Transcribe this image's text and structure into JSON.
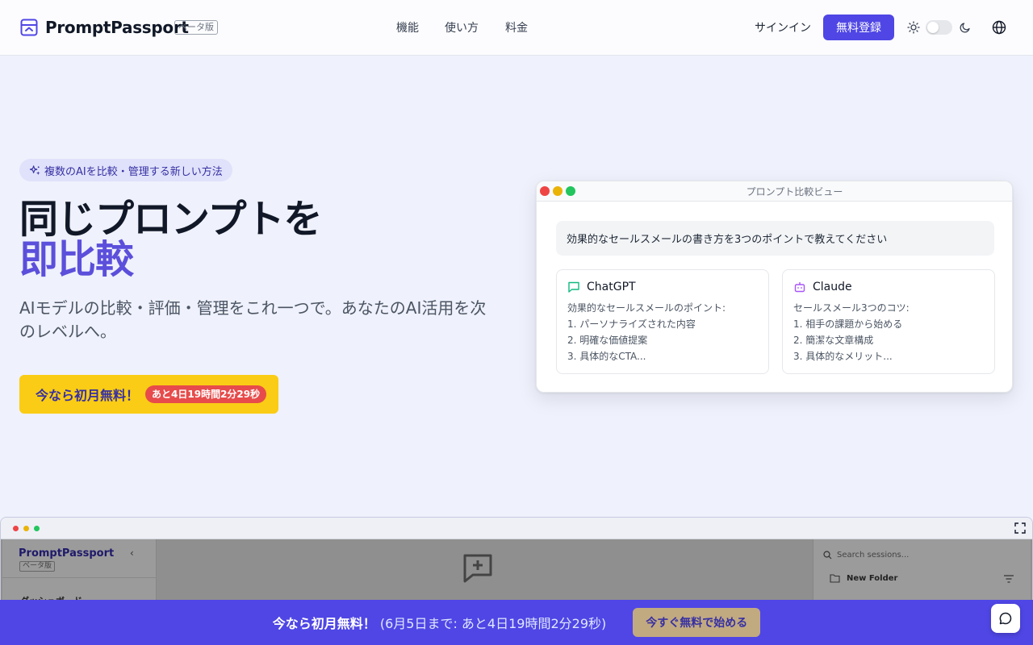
{
  "header": {
    "logo_text": "PromptPassport",
    "beta_label": "ベータ版",
    "nav": [
      {
        "label": "機能"
      },
      {
        "label": "使い方"
      },
      {
        "label": "料金"
      }
    ],
    "signin_label": "サインイン",
    "signup_label": "無料登録",
    "theme_toggle_dark": false
  },
  "hero": {
    "badge": "複数のAIを比較・管理する新しい方法",
    "title_line1": "同じプロンプトを",
    "title_line2": "即比較",
    "subtitle": "AIモデルの比較・評価・管理をこれ一つで。あなたのAI活用を次のレベルへ。",
    "cta_text": "今なら初月無料！",
    "cta_timer": "あと4日19時間2分29秒"
  },
  "compare_card": {
    "window_title": "プロンプト比較ビュー",
    "prompt": "効果的なセールスメールの書き方を3つのポイントで教えてください",
    "responses": [
      {
        "model": "ChatGPT",
        "icon": "message-square-icon",
        "lines": [
          "効果的なセールスメールのポイント:",
          "1. パーソナライズされた内容",
          "2. 明確な価値提案",
          "3. 具体的なCTA..."
        ]
      },
      {
        "model": "Claude",
        "icon": "bot-icon",
        "lines": [
          "セールスメール3つのコツ:",
          "1. 相手の課題から始める",
          "2. 簡潔な文章構成",
          "3. 具体的なメリット..."
        ]
      }
    ]
  },
  "app_preview": {
    "logo": "PromptPassport",
    "beta": "ベータ版",
    "sidebar_item": "ダッシュボード",
    "search_placeholder": "Search sessions...",
    "folder_label": "New Folder"
  },
  "promo_bar": {
    "headline": "今なら初月無料！",
    "detail": "(6月5日まで: あと4日19時間2分29秒)",
    "button": "今すぐ無料で始める"
  },
  "colors": {
    "accent": "#4f46e5",
    "title_accent": "#5b4fdb",
    "cta": "#facc15",
    "timer": "#e74b4b"
  }
}
